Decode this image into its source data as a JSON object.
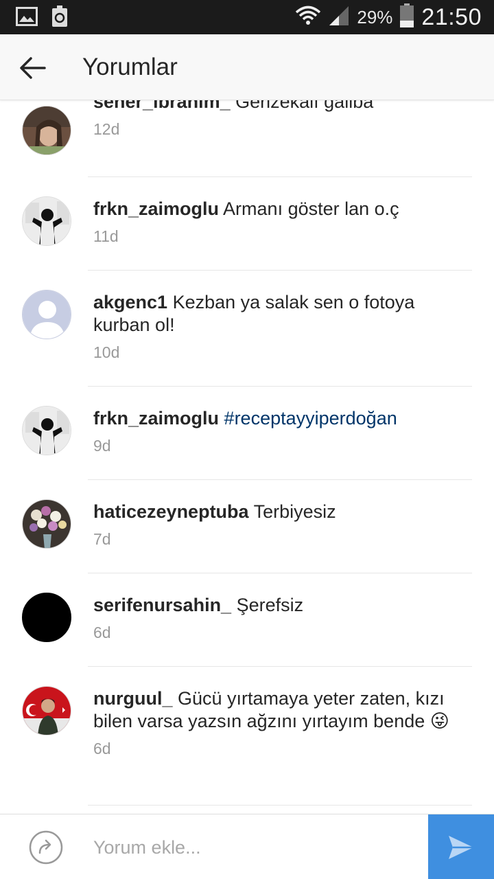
{
  "status_bar": {
    "battery_percent": "29%",
    "time": "21:50",
    "left_icons": [
      "gallery-icon",
      "recycle-icon"
    ],
    "right_icons": [
      "wifi-icon",
      "signal-icon",
      "battery-icon"
    ]
  },
  "header": {
    "title": "Yorumlar",
    "back_icon": "arrow-left-icon"
  },
  "comments": [
    {
      "username": "seher_ibrahim_",
      "text": "Gerizekalı galiba",
      "time": "12d"
    },
    {
      "username": "frkn_zaimoglu",
      "text": "Armanı göster lan o.ç",
      "time": "11d"
    },
    {
      "username": "akgenc1",
      "text": "Kezban ya salak sen o fotoya kurban ol!",
      "time": "10d"
    },
    {
      "username": "frkn_zaimoglu",
      "text": "#receptayyiperdoğan",
      "time": "9d"
    },
    {
      "username": "haticezeyneptuba",
      "text": "Terbiyesiz",
      "time": "7d"
    },
    {
      "username": "serifenursahin_",
      "text": "Şerefsiz",
      "time": "6d"
    },
    {
      "username": "nurguul_",
      "text": "Gücü yırtamaya yeter zaten, kızı bilen varsa yazsın ağzını yırtayım bende",
      "emoji": "😜",
      "time": "6d"
    }
  ],
  "composer": {
    "placeholder": "Yorum ekle...",
    "share_icon": "share-arrow-icon",
    "send_icon": "send-icon",
    "send_color": "#3f8fe0"
  }
}
